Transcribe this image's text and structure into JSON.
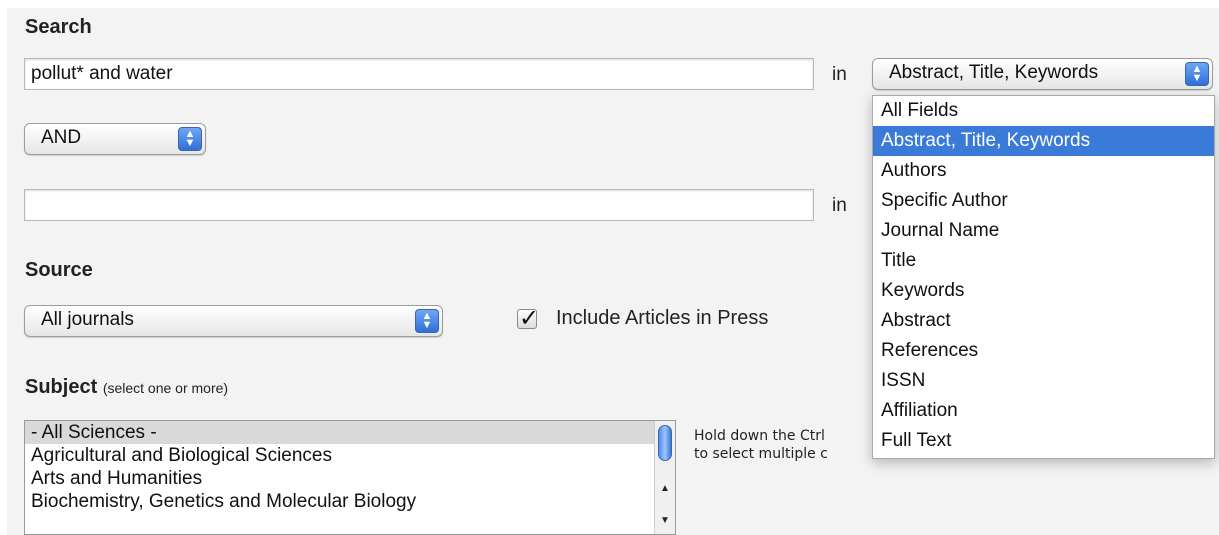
{
  "search": {
    "heading": "Search",
    "query1": "pollut* and water",
    "in_label": "in",
    "field_select": "Abstract, Title, Keywords",
    "operator": "AND",
    "query2": "",
    "in_label2": "in"
  },
  "source": {
    "heading": "Source",
    "select": "All journals",
    "include_label": "Include Articles in Press",
    "include_checked": true
  },
  "subject": {
    "heading": "Subject",
    "note": "(select one or more)",
    "items": [
      "- All Sciences -",
      "Agricultural and Biological Sciences",
      "Arts and Humanities",
      "Biochemistry, Genetics and Molecular Biology"
    ],
    "hint_line1": "Hold down the Ctrl",
    "hint_line2": "to select multiple c"
  },
  "field_dropdown": {
    "options": [
      "All Fields",
      "Abstract, Title, Keywords",
      "Authors",
      "Specific Author",
      "Journal Name",
      "Title",
      "Keywords",
      "Abstract",
      "References",
      "ISSN",
      "Affiliation",
      "Full Text"
    ],
    "highlighted_index": 1
  },
  "icons": {
    "select_arrows": "updown-arrows-icon",
    "checkbox": "checkmark-icon"
  }
}
